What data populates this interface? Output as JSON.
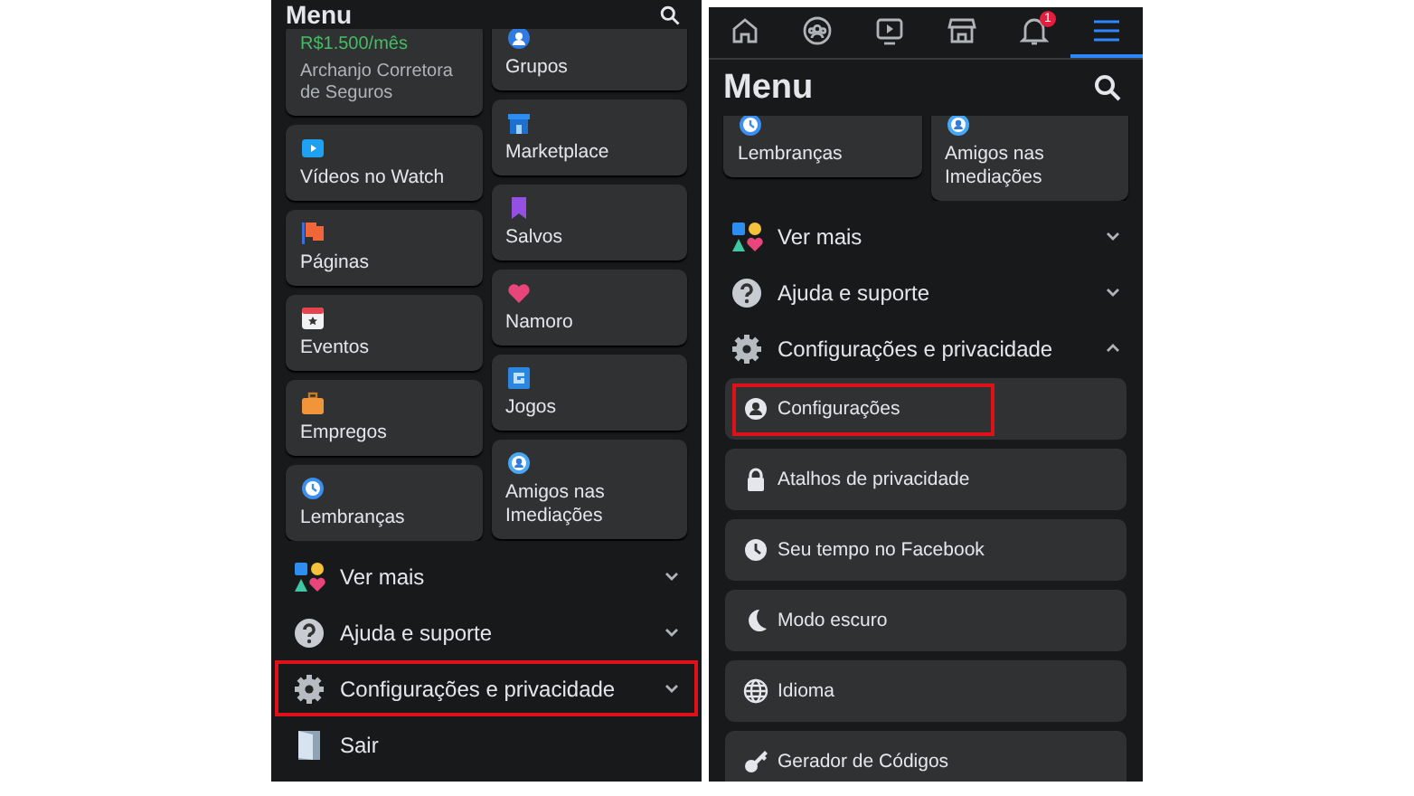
{
  "screens": [
    {
      "title": "Menu",
      "shortcut_columns": [
        [
          {
            "price": "R$1.500/mês",
            "label": "Archanjo Corretora de Seguros"
          },
          {
            "label": "Vídeos no Watch"
          },
          {
            "label": "Páginas"
          },
          {
            "label": "Eventos"
          },
          {
            "label": "Empregos"
          },
          {
            "label": "Lembranças"
          }
        ],
        [
          {
            "label": "Grupos"
          },
          {
            "label": "Marketplace"
          },
          {
            "label": "Salvos"
          },
          {
            "label": "Namoro"
          },
          {
            "label": "Jogos"
          },
          {
            "label": "Amigos nas Imediações"
          }
        ]
      ],
      "sections": [
        {
          "label": "Ver mais",
          "expanded": false,
          "highlighted": false
        },
        {
          "label": "Ajuda e suporte",
          "expanded": false,
          "highlighted": false
        },
        {
          "label": "Configurações e privacidade",
          "expanded": false,
          "highlighted": true
        },
        {
          "label": "Sair",
          "highlighted": false
        }
      ]
    },
    {
      "nav_tabs": [
        {
          "selected": false
        },
        {
          "selected": false
        },
        {
          "selected": false
        },
        {
          "selected": false
        },
        {
          "selected": false,
          "badge": "1"
        },
        {
          "selected": true
        }
      ],
      "title": "Menu",
      "shortcut_columns": [
        [
          {
            "label": "Lembranças"
          }
        ],
        [
          {
            "label": "Amigos nas Imediações"
          }
        ]
      ],
      "sections": [
        {
          "label": "Ver mais",
          "expanded": false,
          "highlighted": false
        },
        {
          "label": "Ajuda e suporte",
          "expanded": false,
          "highlighted": false
        },
        {
          "label": "Configurações e privacidade",
          "expanded": true,
          "highlighted": false
        }
      ],
      "sub_items": [
        {
          "label": "Configurações",
          "highlighted": true
        },
        {
          "label": "Atalhos de privacidade",
          "highlighted": false
        },
        {
          "label": "Seu tempo no Facebook",
          "highlighted": false
        },
        {
          "label": "Modo escuro",
          "highlighted": false
        },
        {
          "label": "Idioma",
          "highlighted": false
        },
        {
          "label": "Gerador de Códigos",
          "highlighted": false
        }
      ]
    }
  ]
}
